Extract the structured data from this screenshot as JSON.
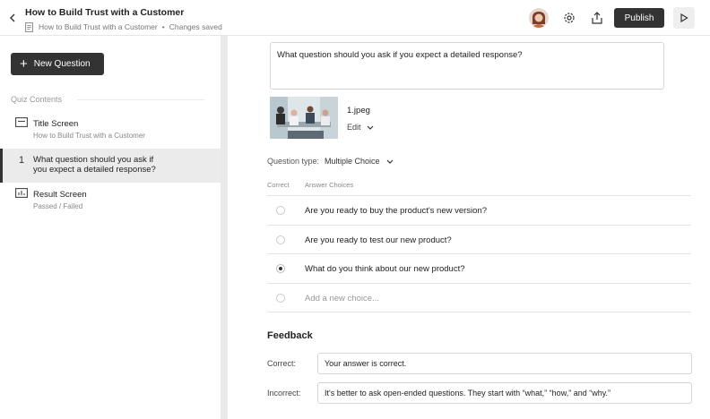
{
  "header": {
    "title": "How to Build Trust with a Customer",
    "breadcrumb": "How to Build Trust with a Customer",
    "separator": "•",
    "status": "Changes saved",
    "publish_label": "Publish"
  },
  "sidebar": {
    "new_question_label": "New Question",
    "contents_label": "Quiz Contents",
    "items": [
      {
        "label": "Title Screen",
        "sub": "How to Build Trust with a Customer",
        "icon": "title-screen-icon"
      },
      {
        "number": "1",
        "label_line1": "What question should you ask if",
        "label_line2": "you expect a detailed response?"
      },
      {
        "label": "Result Screen",
        "sub": "Passed / Failed",
        "icon": "result-chart-icon"
      }
    ]
  },
  "main": {
    "question_text": "What question should you ask if you expect a detailed response?",
    "image_name": "1.jpeg",
    "edit_label": "Edit",
    "question_type_label": "Question type:",
    "question_type_value": "Multiple Choice",
    "col_correct": "Correct",
    "col_choices": "Answer Choices",
    "choices": [
      {
        "text": "Are you ready to buy the product's new version?",
        "correct": false
      },
      {
        "text": "Are you ready to test our new product?",
        "correct": false
      },
      {
        "text": "What do you think about our new product?",
        "correct": true
      }
    ],
    "add_choice_placeholder": "Add a new choice...",
    "feedback_title": "Feedback",
    "correct_label": "Correct:",
    "correct_value": "Your answer is correct.",
    "incorrect_label": "Incorrect:",
    "incorrect_value": "It's better to ask open-ended questions. They start with “what,” “how,” and “why.”"
  },
  "colors": {
    "dark_button": "#333333",
    "active_row": "#ebebeb",
    "divider": "#e9e9e9"
  }
}
